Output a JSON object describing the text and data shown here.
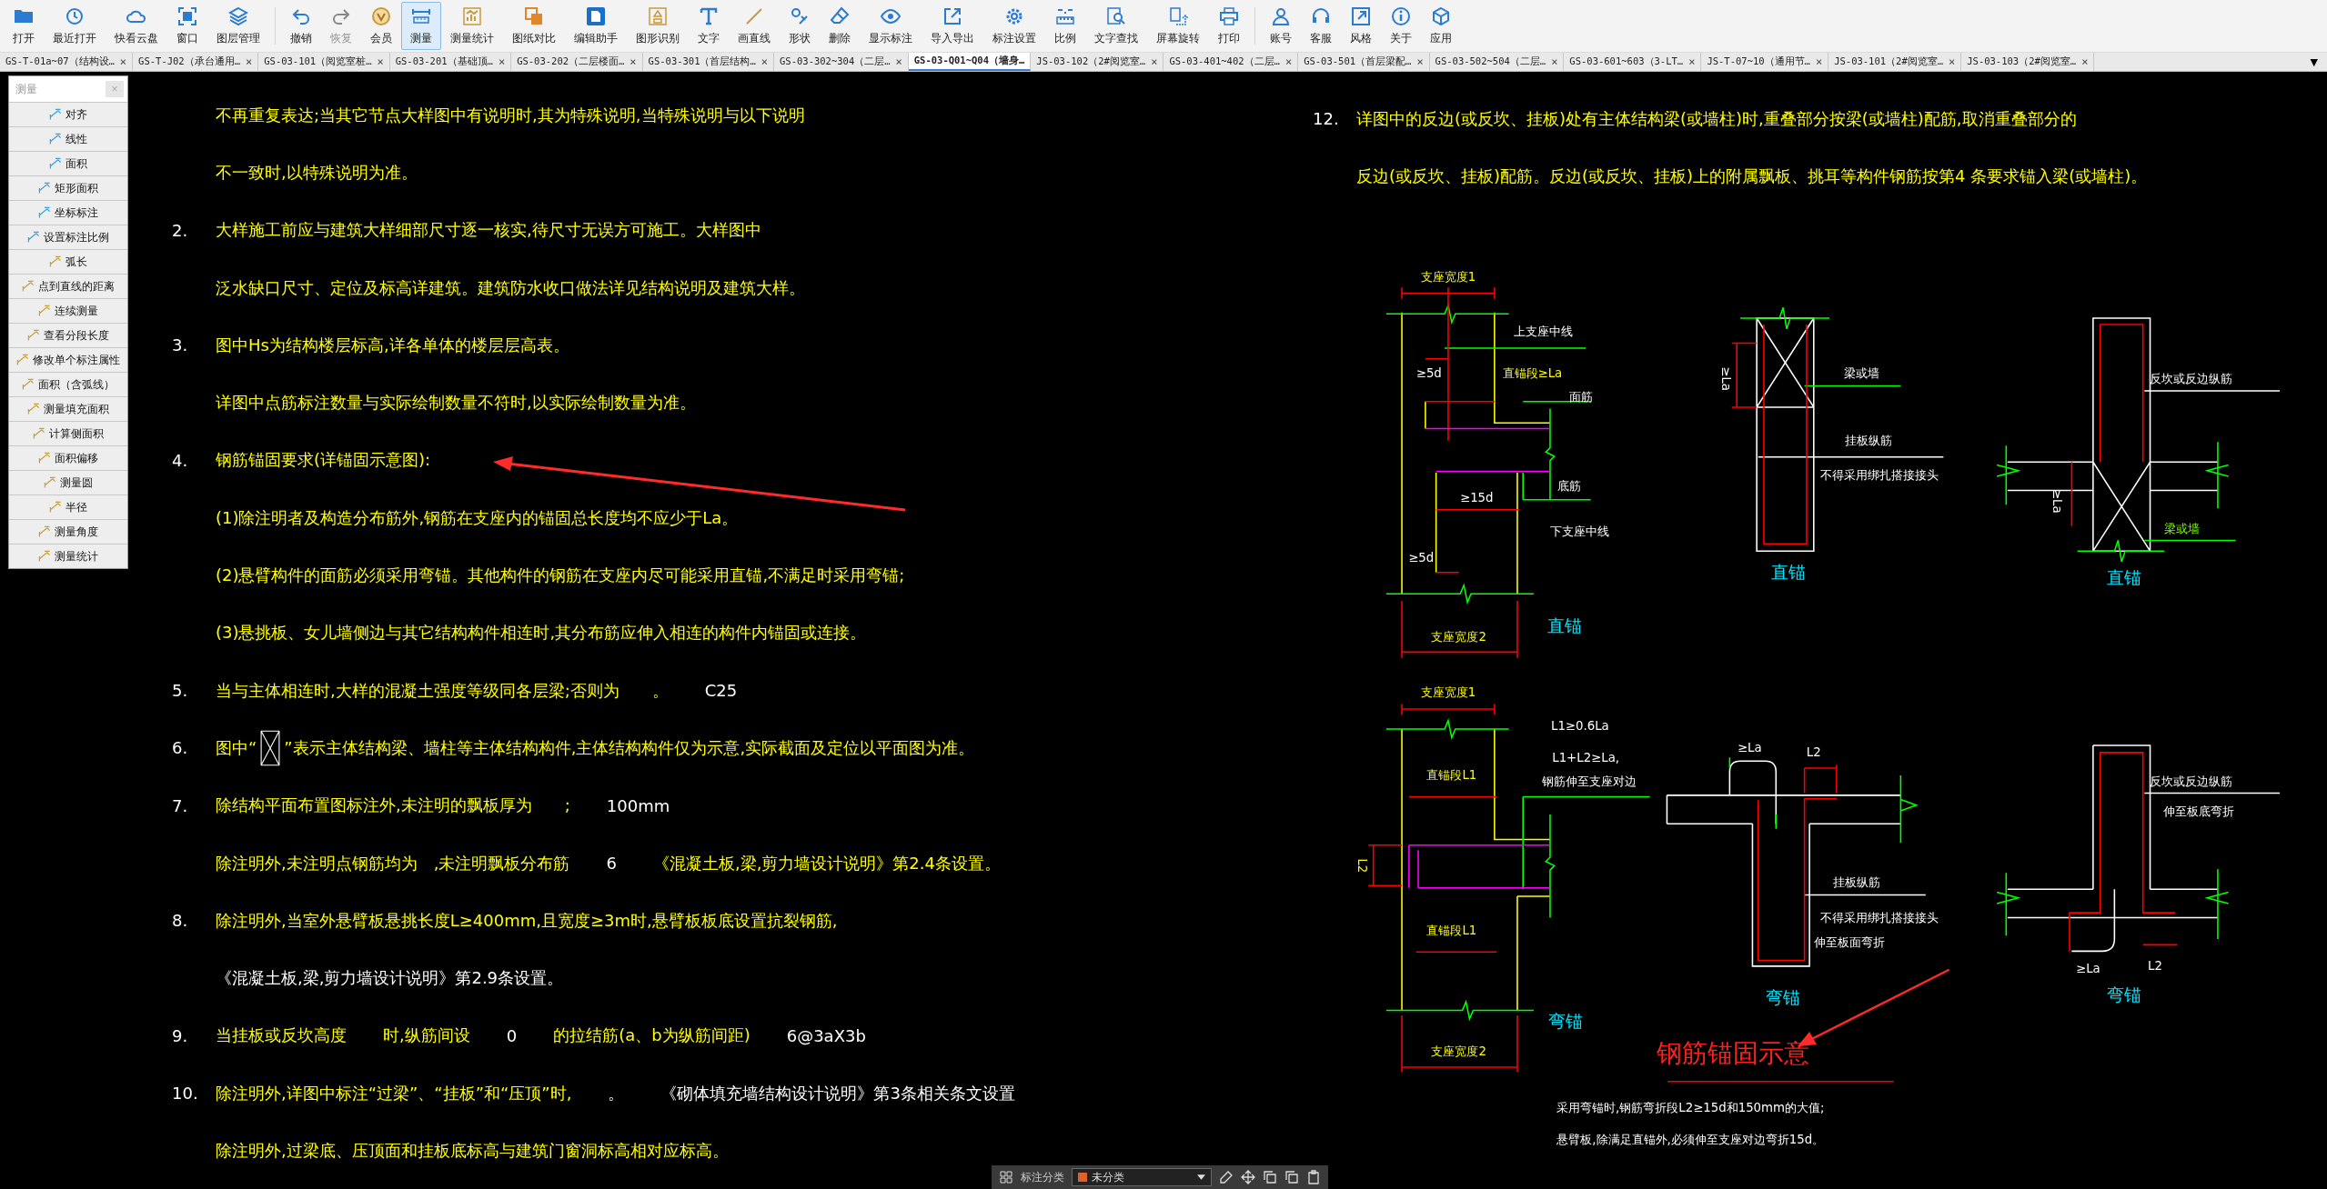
{
  "toolbar": [
    {
      "label": "打开",
      "selected": false,
      "disabled": false
    },
    {
      "label": "最近打开",
      "selected": false,
      "disabled": false
    },
    {
      "label": "快看云盘",
      "selected": false,
      "disabled": false
    },
    {
      "label": "窗口",
      "selected": false,
      "disabled": false
    },
    {
      "label": "图层管理",
      "selected": false,
      "disabled": false
    },
    {
      "label": "撤销",
      "selected": false,
      "disabled": false
    },
    {
      "label": "恢复",
      "selected": false,
      "disabled": true
    },
    {
      "label": "会员",
      "selected": false,
      "disabled": false
    },
    {
      "label": "测量",
      "selected": true,
      "disabled": false
    },
    {
      "label": "测量统计",
      "selected": false,
      "disabled": false
    },
    {
      "label": "图纸对比",
      "selected": false,
      "disabled": false
    },
    {
      "label": "编辑助手",
      "selected": false,
      "disabled": false
    },
    {
      "label": "图形识别",
      "selected": false,
      "disabled": false
    },
    {
      "label": "文字",
      "selected": false,
      "disabled": false
    },
    {
      "label": "画直线",
      "selected": false,
      "disabled": false
    },
    {
      "label": "形状",
      "selected": false,
      "disabled": false
    },
    {
      "label": "删除",
      "selected": false,
      "disabled": false
    },
    {
      "label": "显示标注",
      "selected": false,
      "disabled": false
    },
    {
      "label": "导入导出",
      "selected": false,
      "disabled": false
    },
    {
      "label": "标注设置",
      "selected": false,
      "disabled": false
    },
    {
      "label": "比例",
      "selected": false,
      "disabled": false
    },
    {
      "label": "文字查找",
      "selected": false,
      "disabled": false
    },
    {
      "label": "屏幕旋转",
      "selected": false,
      "disabled": false
    },
    {
      "label": "打印",
      "selected": false,
      "disabled": false
    },
    {
      "label": "账号",
      "selected": false,
      "disabled": false
    },
    {
      "label": "客服",
      "selected": false,
      "disabled": false
    },
    {
      "label": "风格",
      "selected": false,
      "disabled": false
    },
    {
      "label": "关于",
      "selected": false,
      "disabled": false
    },
    {
      "label": "应用",
      "selected": false,
      "disabled": false
    }
  ],
  "tabs": [
    {
      "label": "GS-T-01a~07（结构设…",
      "selected": false,
      "close": "×"
    },
    {
      "label": "GS-T-J02（承台通用…",
      "selected": false,
      "close": "×"
    },
    {
      "label": "GS-03-101（阅览室桩…",
      "selected": false,
      "close": "×"
    },
    {
      "label": "GS-03-201（基础顶…",
      "selected": false,
      "close": "×"
    },
    {
      "label": "GS-03-202（二层楼面…",
      "selected": false,
      "close": "×"
    },
    {
      "label": "GS-03-301（首层结构…",
      "selected": false,
      "close": "×"
    },
    {
      "label": "GS-03-302~304（二层…",
      "selected": false,
      "close": "×"
    },
    {
      "label": "GS-03-Q01~Q04（墙身…",
      "selected": true
    },
    {
      "label": "JS-03-102（2#阅览室…",
      "selected": false,
      "close": "×"
    },
    {
      "label": "GS-03-401~402（二层…",
      "selected": false,
      "close": "×"
    },
    {
      "label": "GS-03-501（首层梁配…",
      "selected": false,
      "close": "×"
    },
    {
      "label": "GS-03-502~504（二层…",
      "selected": false,
      "close": "×"
    },
    {
      "label": "GS-03-601~603（3-LT…",
      "selected": false,
      "close": "×"
    },
    {
      "label": "JS-T-07~10（通用节…",
      "selected": false,
      "close": "×"
    },
    {
      "label": "JS-03-101（2#阅览室…",
      "selected": false,
      "close": "×"
    },
    {
      "label": "JS-03-103（2#阅览室…",
      "selected": false,
      "close": "×"
    }
  ],
  "tab_menu": "▼",
  "measure_panel": {
    "title": "测量",
    "close": "×",
    "items": [
      "对齐",
      "线性",
      "面积",
      "矩形面积",
      "坐标标注",
      "设置标注比例",
      "弧长",
      "点到直线的距离",
      "连续测量",
      "查看分段长度",
      "修改单个标注属性",
      "面积（含弧线）",
      "测量填充面积",
      "计算侧面积",
      "面积偏移",
      "测量圆",
      "半径",
      "测量角度",
      "测量统计"
    ]
  },
  "notes": [
    {
      "parts": [
        {
          "kind": "note",
          "text": "不再重复表达;当其它节点大样图中有说明时,其为特殊说明,当特殊说明与以下说明"
        }
      ]
    },
    {
      "parts": [
        {
          "kind": "note",
          "text": "不一致时,以特殊说明为准。"
        }
      ]
    },
    {
      "number": "2.",
      "parts": [
        {
          "kind": "note",
          "text": "大样施工前应与建筑大样细部尺寸逐一核实,待尺寸无误方可施工。大样图中"
        }
      ]
    },
    {
      "parts": [
        {
          "kind": "note",
          "text": "泛水缺口尺寸、定位及标高详建筑。建筑防水收口做法详见结构说明及建筑大样。"
        }
      ]
    },
    {
      "number": "3.",
      "parts": [
        {
          "kind": "note",
          "text": "图中Hs为结构楼层标高,详各单体的楼层层高表。"
        }
      ]
    },
    {
      "parts": [
        {
          "kind": "note",
          "text": "详图中点筋标注数量与实际绘制数量不符时,以实际绘制数量为准。"
        }
      ]
    },
    {
      "number": "4.",
      "parts": [
        {
          "kind": "note",
          "text": "钢筋锚固要求(详锚固示意图):"
        }
      ]
    },
    {
      "parts": [
        {
          "kind": "note",
          "text": "(1)除注明者及构造分布筋外,钢筋在支座内的锚固总长度均不应少于La。"
        }
      ]
    },
    {
      "parts": [
        {
          "kind": "note",
          "text": "(2)悬臂构件的面筋必须采用弯锚。其他构件的钢筋在支座内尽可能采用直锚,不满足时采用弯锚;"
        }
      ]
    },
    {
      "parts": [
        {
          "kind": "note",
          "text": "(3)悬挑板、女儿墙侧边与其它结构构件相连时,其分布筋应伸入相连的构件内锚固或连接。"
        }
      ]
    },
    {
      "number": "5.",
      "parts": [
        {
          "kind": "note",
          "text": "当与主体相连时,大样的混凝土强度等级同各层梁;否则为　　。"
        },
        {
          "kind": "value",
          "text": "C25"
        }
      ]
    },
    {
      "number": "6.",
      "parts": [
        {
          "kind": "note",
          "text": "图中“"
        },
        {
          "kind": "symbol"
        },
        {
          "kind": "note",
          "text": "”表示主体结构梁、墙柱等主体结构构件,主体结构构件仅为示意,实际截面及定位以平面图为准。"
        }
      ]
    },
    {
      "number": "7.",
      "parts": [
        {
          "kind": "note",
          "text": "除结构平面布置图标注外,未注明的飘板厚为　　;"
        },
        {
          "kind": "value",
          "text": "100mm"
        }
      ]
    },
    {
      "parts": [
        {
          "kind": "note",
          "text": "除注明外,未注明点钢筋均为　,未注明飘板分布筋"
        },
        {
          "kind": "value",
          "text": "6"
        },
        {
          "kind": "note",
          "text": "《混凝土板,梁,剪力墙设计说明》第2.4条设置。"
        }
      ]
    },
    {
      "number": "8.",
      "parts": [
        {
          "kind": "note",
          "text": "除注明外,当室外悬臂板悬挑长度L≥400mm,且宽度≥3m时,悬臂板板底设置抗裂钢筋,"
        }
      ]
    },
    {
      "parts": [
        {
          "kind": "value",
          "text": "《混凝土板,梁,剪力墙设计说明》第2.9条设置。"
        }
      ]
    },
    {
      "number": "9.",
      "parts": [
        {
          "kind": "note",
          "text": "当挂板或反坎高度"
        },
        {
          "kind": "note",
          "text": "时,纵筋间设"
        },
        {
          "kind": "value",
          "text": "0"
        },
        {
          "kind": "note",
          "text": "的拉结筋(a、b为纵筋间距)"
        },
        {
          "kind": "value",
          "text": "6@3aX3b"
        }
      ]
    },
    {
      "number": "10.",
      "parts": [
        {
          "kind": "note",
          "text": "除注明外,详图中标注“过梁”、“挂板”和“压顶”时,"
        },
        {
          "kind": "value",
          "text": "。"
        },
        {
          "kind": "value",
          "text": "《砌体填充墙结构设计说明》第3条相关条文设置"
        }
      ]
    },
    {
      "parts": [
        {
          "kind": "note",
          "text": "除注明外,过梁底、压顶面和挂板底标高与建筑门窗洞标高相对应标高。"
        }
      ]
    }
  ],
  "note_12": {
    "number": "12.",
    "lines": [
      "详图中的反边(或反坎、挂板)处有主体结构梁(或墙柱)时,重叠部分按梁(或墙柱)配筋,取消重叠部分的",
      "反边(或反坎、挂板)配筋。反边(或反坎、挂板)上的附属飘板、挑耳等构件钢筋按第4 条要求锚入梁(或墙柱)。"
    ]
  },
  "details": [
    {
      "caption": "直锚",
      "labels": [
        {
          "kind": "dimension",
          "text": "支座宽度1"
        },
        {
          "kind": "callout",
          "text": "上支座中线"
        },
        {
          "kind": "callout",
          "text": "≥5d"
        },
        {
          "kind": "dimension",
          "text": "直锚段≥La"
        },
        {
          "kind": "callout",
          "text": "面筋"
        },
        {
          "kind": "callout",
          "text": "底筋"
        },
        {
          "kind": "callout",
          "text": "≥15d"
        },
        {
          "kind": "callout",
          "text": "下支座中线"
        },
        {
          "kind": "callout",
          "text": "≥5d"
        },
        {
          "kind": "dimension",
          "text": "支座宽度2"
        }
      ]
    },
    {
      "caption": "直锚",
      "labels": [
        {
          "kind": "callout",
          "text": "≥La"
        },
        {
          "kind": "callout",
          "text": "梁或墙"
        },
        {
          "kind": "callout",
          "text": "挂板纵筋"
        },
        {
          "kind": "callout",
          "text": "不得采用绑扎搭接接头"
        }
      ]
    },
    {
      "caption": "直锚",
      "labels": [
        {
          "kind": "callout",
          "text": "反坎或反边纵筋"
        },
        {
          "kind": "callout",
          "text": "≥La"
        },
        {
          "kind": "green",
          "text": "梁或墙"
        }
      ]
    },
    {
      "caption": "弯锚",
      "labels": [
        {
          "kind": "dimension",
          "text": "支座宽度1"
        },
        {
          "kind": "dimension",
          "text": "直锚段L1"
        },
        {
          "kind": "callout",
          "text": "L1≥0.6La"
        },
        {
          "kind": "callout",
          "text": "L1+L2≥La,"
        },
        {
          "kind": "callout",
          "text": "钢筋伸至支座对边"
        },
        {
          "kind": "dimension",
          "text": "L2"
        },
        {
          "kind": "dimension",
          "text": "直锚段L1"
        },
        {
          "kind": "dimension",
          "text": "支座宽度2"
        }
      ]
    },
    {
      "caption": "弯锚",
      "labels": [
        {
          "kind": "callout",
          "text": "≥La"
        },
        {
          "kind": "callout",
          "text": "L2"
        },
        {
          "kind": "callout",
          "text": "挂板纵筋"
        },
        {
          "kind": "callout",
          "text": "不得采用绑扎搭接接头"
        },
        {
          "kind": "callout",
          "text": "伸至板面弯折"
        }
      ]
    },
    {
      "caption": "弯锚",
      "labels": [
        {
          "kind": "callout",
          "text": "反坎或反边纵筋"
        },
        {
          "kind": "callout",
          "text": "伸至板底弯折"
        },
        {
          "kind": "callout",
          "text": "≥La"
        },
        {
          "kind": "callout",
          "text": "L2"
        }
      ]
    }
  ],
  "diagram_title": "钢筋锚固示意",
  "diagram_notes": [
    "采用弯锚时,钢筋弯折段L2≥15d和150mm的大值;",
    "悬臂板,除满足直锚外,必须伸至支座对边弯折15d。"
  ],
  "annotation_bar": {
    "label": "标注分类",
    "category": "未分类"
  }
}
